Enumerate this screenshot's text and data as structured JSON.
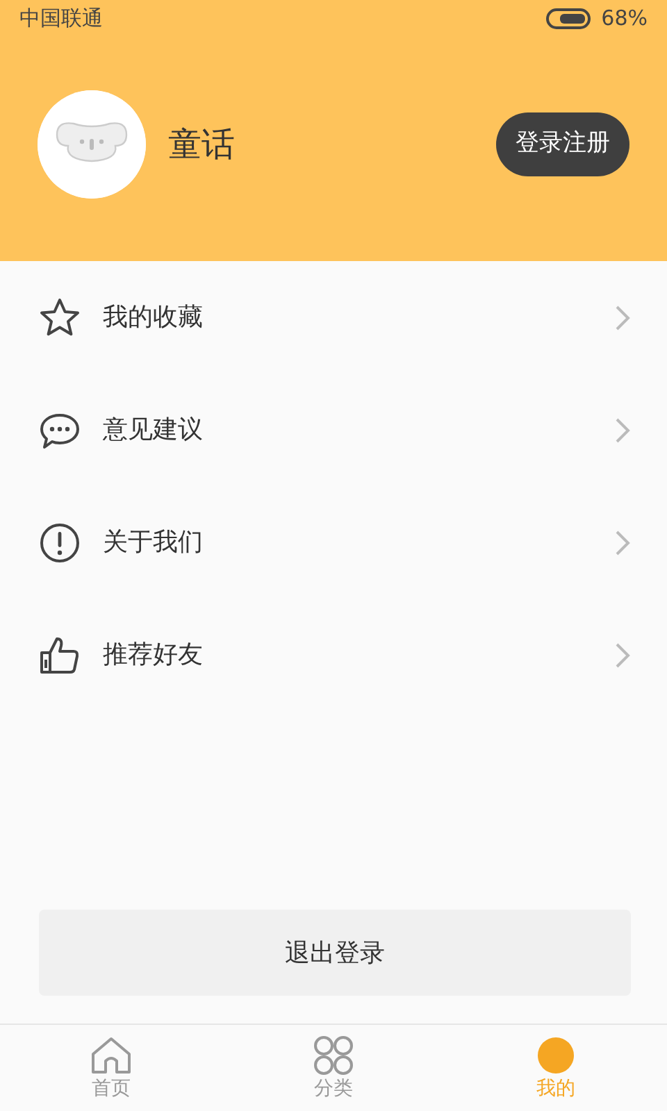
{
  "status_bar": {
    "carrier": "中国联通",
    "battery": "68%"
  },
  "profile": {
    "name": "童话",
    "login_button": "登录注册"
  },
  "menu": [
    {
      "label": "我的收藏"
    },
    {
      "label": "意见建议"
    },
    {
      "label": "关于我们"
    },
    {
      "label": "推荐好友"
    }
  ],
  "logout_button": "退出登录",
  "tabs": [
    {
      "label": "首页",
      "selected": false
    },
    {
      "label": "分类",
      "selected": false
    },
    {
      "label": "我的",
      "selected": true
    }
  ]
}
